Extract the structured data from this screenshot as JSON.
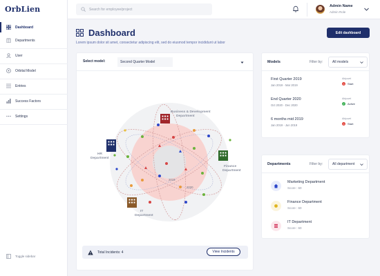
{
  "app": {
    "logo": "OrbLien"
  },
  "sidebar": {
    "items": [
      {
        "label": "Dashboard",
        "icon": "grid-icon"
      },
      {
        "label": "Departments",
        "icon": "building-icon"
      },
      {
        "label": "User",
        "icon": "user-icon"
      },
      {
        "label": "Orbital Model",
        "icon": "orbit-icon"
      },
      {
        "label": "Entries",
        "icon": "list-icon"
      },
      {
        "label": "Success Factors",
        "icon": "bar-chart-icon"
      },
      {
        "label": "Settings",
        "icon": "dots-icon"
      }
    ],
    "toggle_label": "Toggle sidebar"
  },
  "topbar": {
    "search_placeholder": "Search for employee/project",
    "user_name": "Admin Name",
    "user_role": "Admin Role"
  },
  "page": {
    "title": "Dashboard",
    "subtitle": "Lorem ipsum dolor sit amet, consectetur adipiscing elit, sed do eiusmod tempor incididunt ut labor",
    "edit_button": "Edit dashboard"
  },
  "model_panel": {
    "select_label": "Select model:",
    "selected_model": "Second Quarter Model",
    "departments": [
      {
        "name": "Business & Development",
        "name2": "Department",
        "color": "#a0262b"
      },
      {
        "name": "HR",
        "name2": "Department",
        "color": "#1f2f6b"
      },
      {
        "name": "Finance",
        "name2": "Department",
        "color": "#2f6b2a"
      },
      {
        "name": "IT",
        "name2": "Department",
        "color": "#8a5a2a"
      }
    ],
    "year_labels": [
      "2019",
      "2020"
    ],
    "incidents_label": "Total Incidents: 4",
    "view_incidents_button": "View Incidents"
  },
  "models": {
    "title": "Models",
    "filter_label": "Filter by:",
    "filter_value": "All models",
    "status_label": "Aktyuvel",
    "rows": [
      {
        "name": "First Quarter 2019",
        "dates": "Jan 2019 - Mar 2019",
        "status": "Start",
        "status_color": "red"
      },
      {
        "name": "End Quarter 2020",
        "dates": "Oct 2020 - Dec 2020",
        "status": "Active",
        "status_color": "green"
      },
      {
        "name": "6 months mid 2019",
        "dates": "Jan 2019 - Jun 2019",
        "status": "Start",
        "status_color": "red"
      }
    ]
  },
  "departments": {
    "title": "Departments",
    "filter_label": "Filter by:",
    "filter_value": "All department",
    "rows": [
      {
        "name": "Marketing Department",
        "score": "Score : 60",
        "color": "#e8ecfb",
        "icon_color": "#2b46c9"
      },
      {
        "name": "Finance Department",
        "score": "Score : 60",
        "color": "#fbf4dc",
        "icon_color": "#e0b41c"
      },
      {
        "name": "IT Department",
        "score": "Score : 60",
        "color": "#fbe7ec",
        "icon_color": "#d6476a"
      }
    ]
  }
}
